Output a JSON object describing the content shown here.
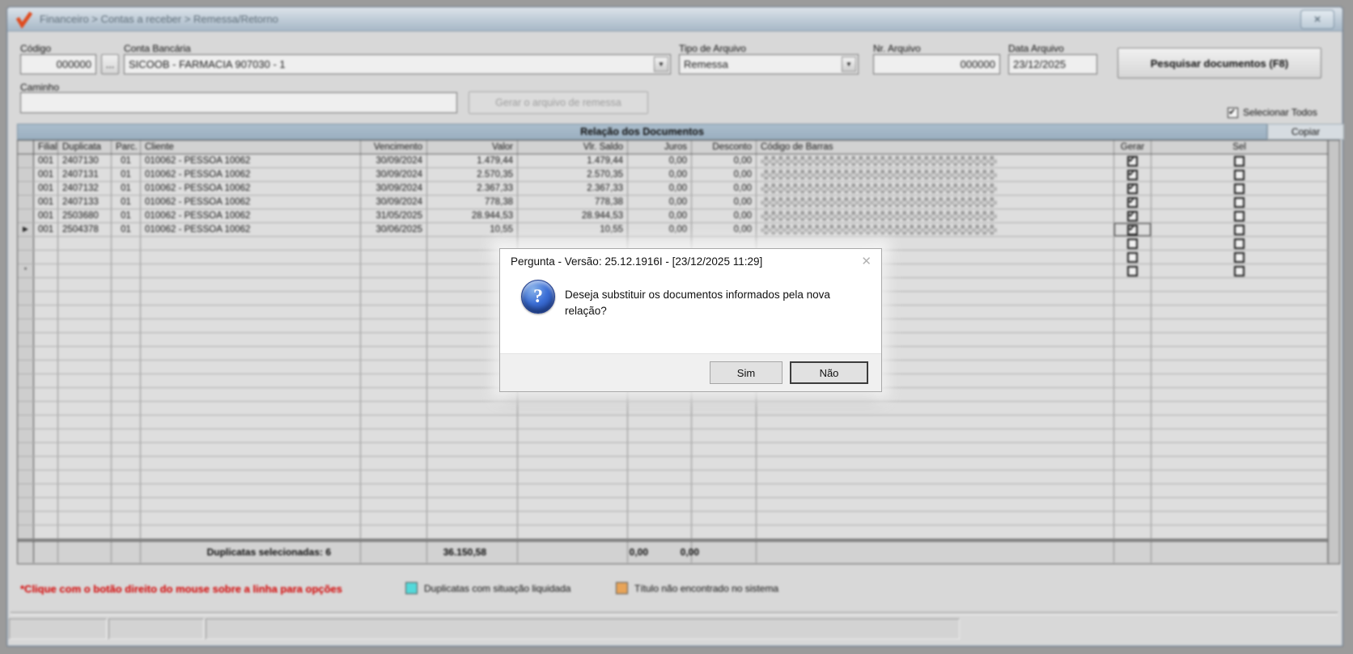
{
  "window": {
    "title": "Financeiro > Contas a receber > Remessa/Retorno"
  },
  "icons": {
    "logo": "check-mark",
    "window_close": "✕",
    "dropdown": "▼",
    "dialog_close": "✕",
    "question": "?",
    "current_row_arrow": "▶",
    "insert_row_marker": "*",
    "checked_glyph": "✔"
  },
  "form": {
    "codigo": {
      "label": "Código",
      "value": "000000"
    },
    "browse_label": "...",
    "conta_bancaria": {
      "label": "Conta Bancária",
      "value": "SICOOB - FARMACIA 907030 - 1"
    },
    "tipo_arquivo": {
      "label": "Tipo de Arquivo",
      "value": "Remessa"
    },
    "nr_arquivo": {
      "label": "Nr. Arquivo",
      "value": "000000"
    },
    "data_arquivo": {
      "label": "Data Arquivo",
      "value": "23/12/2025"
    },
    "pesquisar_label": "Pesquisar documentos (F8)",
    "caminho": {
      "label": "Caminho",
      "value": ""
    },
    "gerar_remessa_label": "Gerar o arquivo de remessa",
    "selecionar_todos": {
      "label": "Selecionar Todos",
      "checked": true
    }
  },
  "grid": {
    "section_title": "Relação dos Documentos",
    "copiar_label": "Copiar",
    "columns": [
      "Filial",
      "Duplicata",
      "Parc.",
      "Cliente",
      "Vencimento",
      "Valor",
      "Vlr. Saldo",
      "Juros",
      "Desconto",
      "Código de Barras",
      "Gerar",
      "Sel"
    ],
    "rows": [
      {
        "filial": "001",
        "duplicata": "2407130",
        "parc": "01",
        "cliente": "010062 - PESSOA 10062",
        "vencimento": "30/09/2024",
        "valor": "1.479,44",
        "saldo": "1.479,44",
        "juros": "0,00",
        "desconto": "0,00",
        "barcode_masked": true,
        "gerar": true,
        "sel": false,
        "current": false
      },
      {
        "filial": "001",
        "duplicata": "2407131",
        "parc": "01",
        "cliente": "010062 - PESSOA 10062",
        "vencimento": "30/09/2024",
        "valor": "2.570,35",
        "saldo": "2.570,35",
        "juros": "0,00",
        "desconto": "0,00",
        "barcode_masked": true,
        "gerar": true,
        "sel": false,
        "current": false
      },
      {
        "filial": "001",
        "duplicata": "2407132",
        "parc": "01",
        "cliente": "010062 - PESSOA 10062",
        "vencimento": "30/09/2024",
        "valor": "2.367,33",
        "saldo": "2.367,33",
        "juros": "0,00",
        "desconto": "0,00",
        "barcode_masked": true,
        "gerar": true,
        "sel": false,
        "current": false
      },
      {
        "filial": "001",
        "duplicata": "2407133",
        "parc": "01",
        "cliente": "010062 - PESSOA 10062",
        "vencimento": "30/09/2024",
        "valor": "778,38",
        "saldo": "778,38",
        "juros": "0,00",
        "desconto": "0,00",
        "barcode_masked": true,
        "gerar": true,
        "sel": false,
        "current": false
      },
      {
        "filial": "001",
        "duplicata": "2503680",
        "parc": "01",
        "cliente": "010062 - PESSOA 10062",
        "vencimento": "31/05/2025",
        "valor": "28.944,53",
        "saldo": "28.944,53",
        "juros": "0,00",
        "desconto": "0,00",
        "barcode_masked": true,
        "gerar": true,
        "sel": false,
        "current": false
      },
      {
        "filial": "001",
        "duplicata": "2504378",
        "parc": "01",
        "cliente": "010062 - PESSOA 10062",
        "vencimento": "30/06/2025",
        "valor": "10,55",
        "saldo": "10,55",
        "juros": "0,00",
        "desconto": "0,00",
        "barcode_masked": true,
        "gerar": true,
        "sel": false,
        "current": true
      }
    ],
    "pending_rows": [
      {
        "marker": "",
        "gerar": false,
        "sel": false
      },
      {
        "marker": "",
        "gerar": false,
        "sel": false
      },
      {
        "marker": "*",
        "gerar": false,
        "sel": false
      }
    ],
    "empty_row_count": 19,
    "totals": {
      "label": "Duplicatas selecionadas: 6",
      "valor": "36.150,58",
      "juros": "0,00",
      "desconto": "0,00"
    }
  },
  "legend": {
    "note": "*Clique com o botão direito do mouse sobre a linha para opções",
    "note_color": "#d40000",
    "items": [
      {
        "color": "#53d9da",
        "label": "Duplicatas com situação liquidada"
      },
      {
        "color": "#e8a458",
        "label": "Título não encontrado no sistema"
      }
    ]
  },
  "dialog": {
    "title": "Pergunta - Versão: 25.12.1916I - [23/12/2025 11:29]",
    "message": "Deseja substituir os documentos informados pela nova relação?",
    "yes_label": "Sim",
    "no_label": "Não"
  }
}
